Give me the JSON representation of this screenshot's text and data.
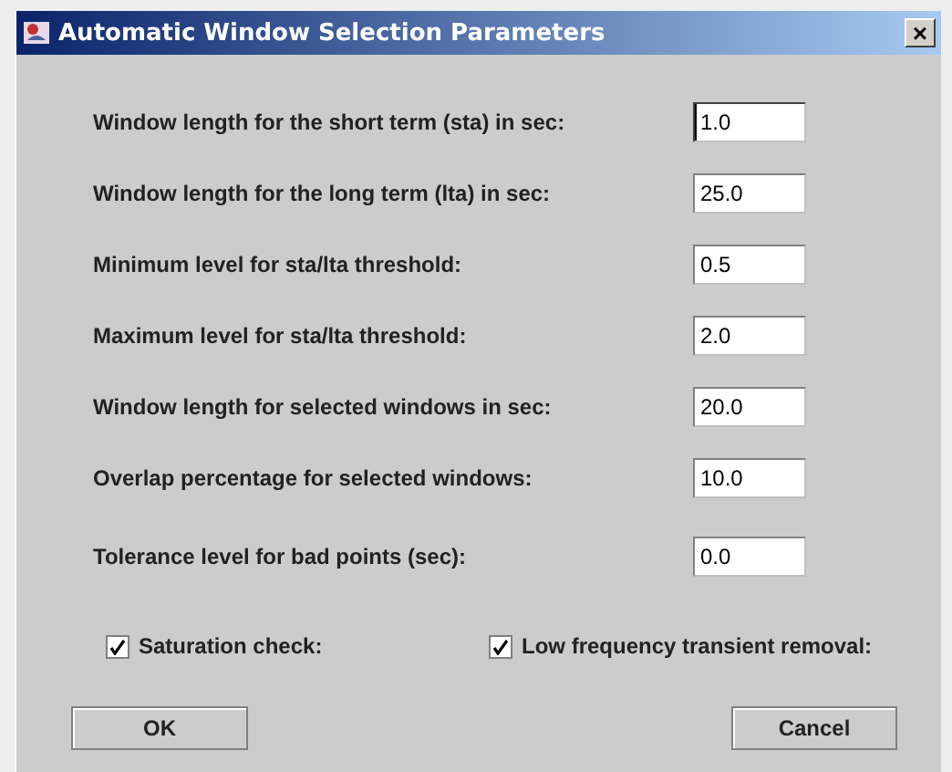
{
  "window": {
    "title": "Automatic Window Selection Parameters",
    "close": "×"
  },
  "fields": [
    {
      "label": "Window length for the short term (sta) in sec:",
      "value": "1.0",
      "focused": true
    },
    {
      "label": "Window length for the long term (lta) in sec:",
      "value": "25.0",
      "focused": false
    },
    {
      "label": "Minimum level for sta/lta threshold:",
      "value": "0.5",
      "focused": false
    },
    {
      "label": "Maximum level for sta/lta threshold:",
      "value": "2.0",
      "focused": false
    },
    {
      "label": "Window length for selected windows in sec:",
      "value": "20.0",
      "focused": false
    },
    {
      "label": "Overlap percentage for selected windows:",
      "value": "10.0",
      "focused": false
    },
    {
      "label": "Tolerance level for bad points (sec):",
      "value": "0.0",
      "focused": false
    }
  ],
  "checkboxes": [
    {
      "label": "Saturation check:",
      "checked": true
    },
    {
      "label": "Low frequency transient removal:",
      "checked": true
    }
  ],
  "buttons": [
    "OK",
    "Cancel"
  ]
}
